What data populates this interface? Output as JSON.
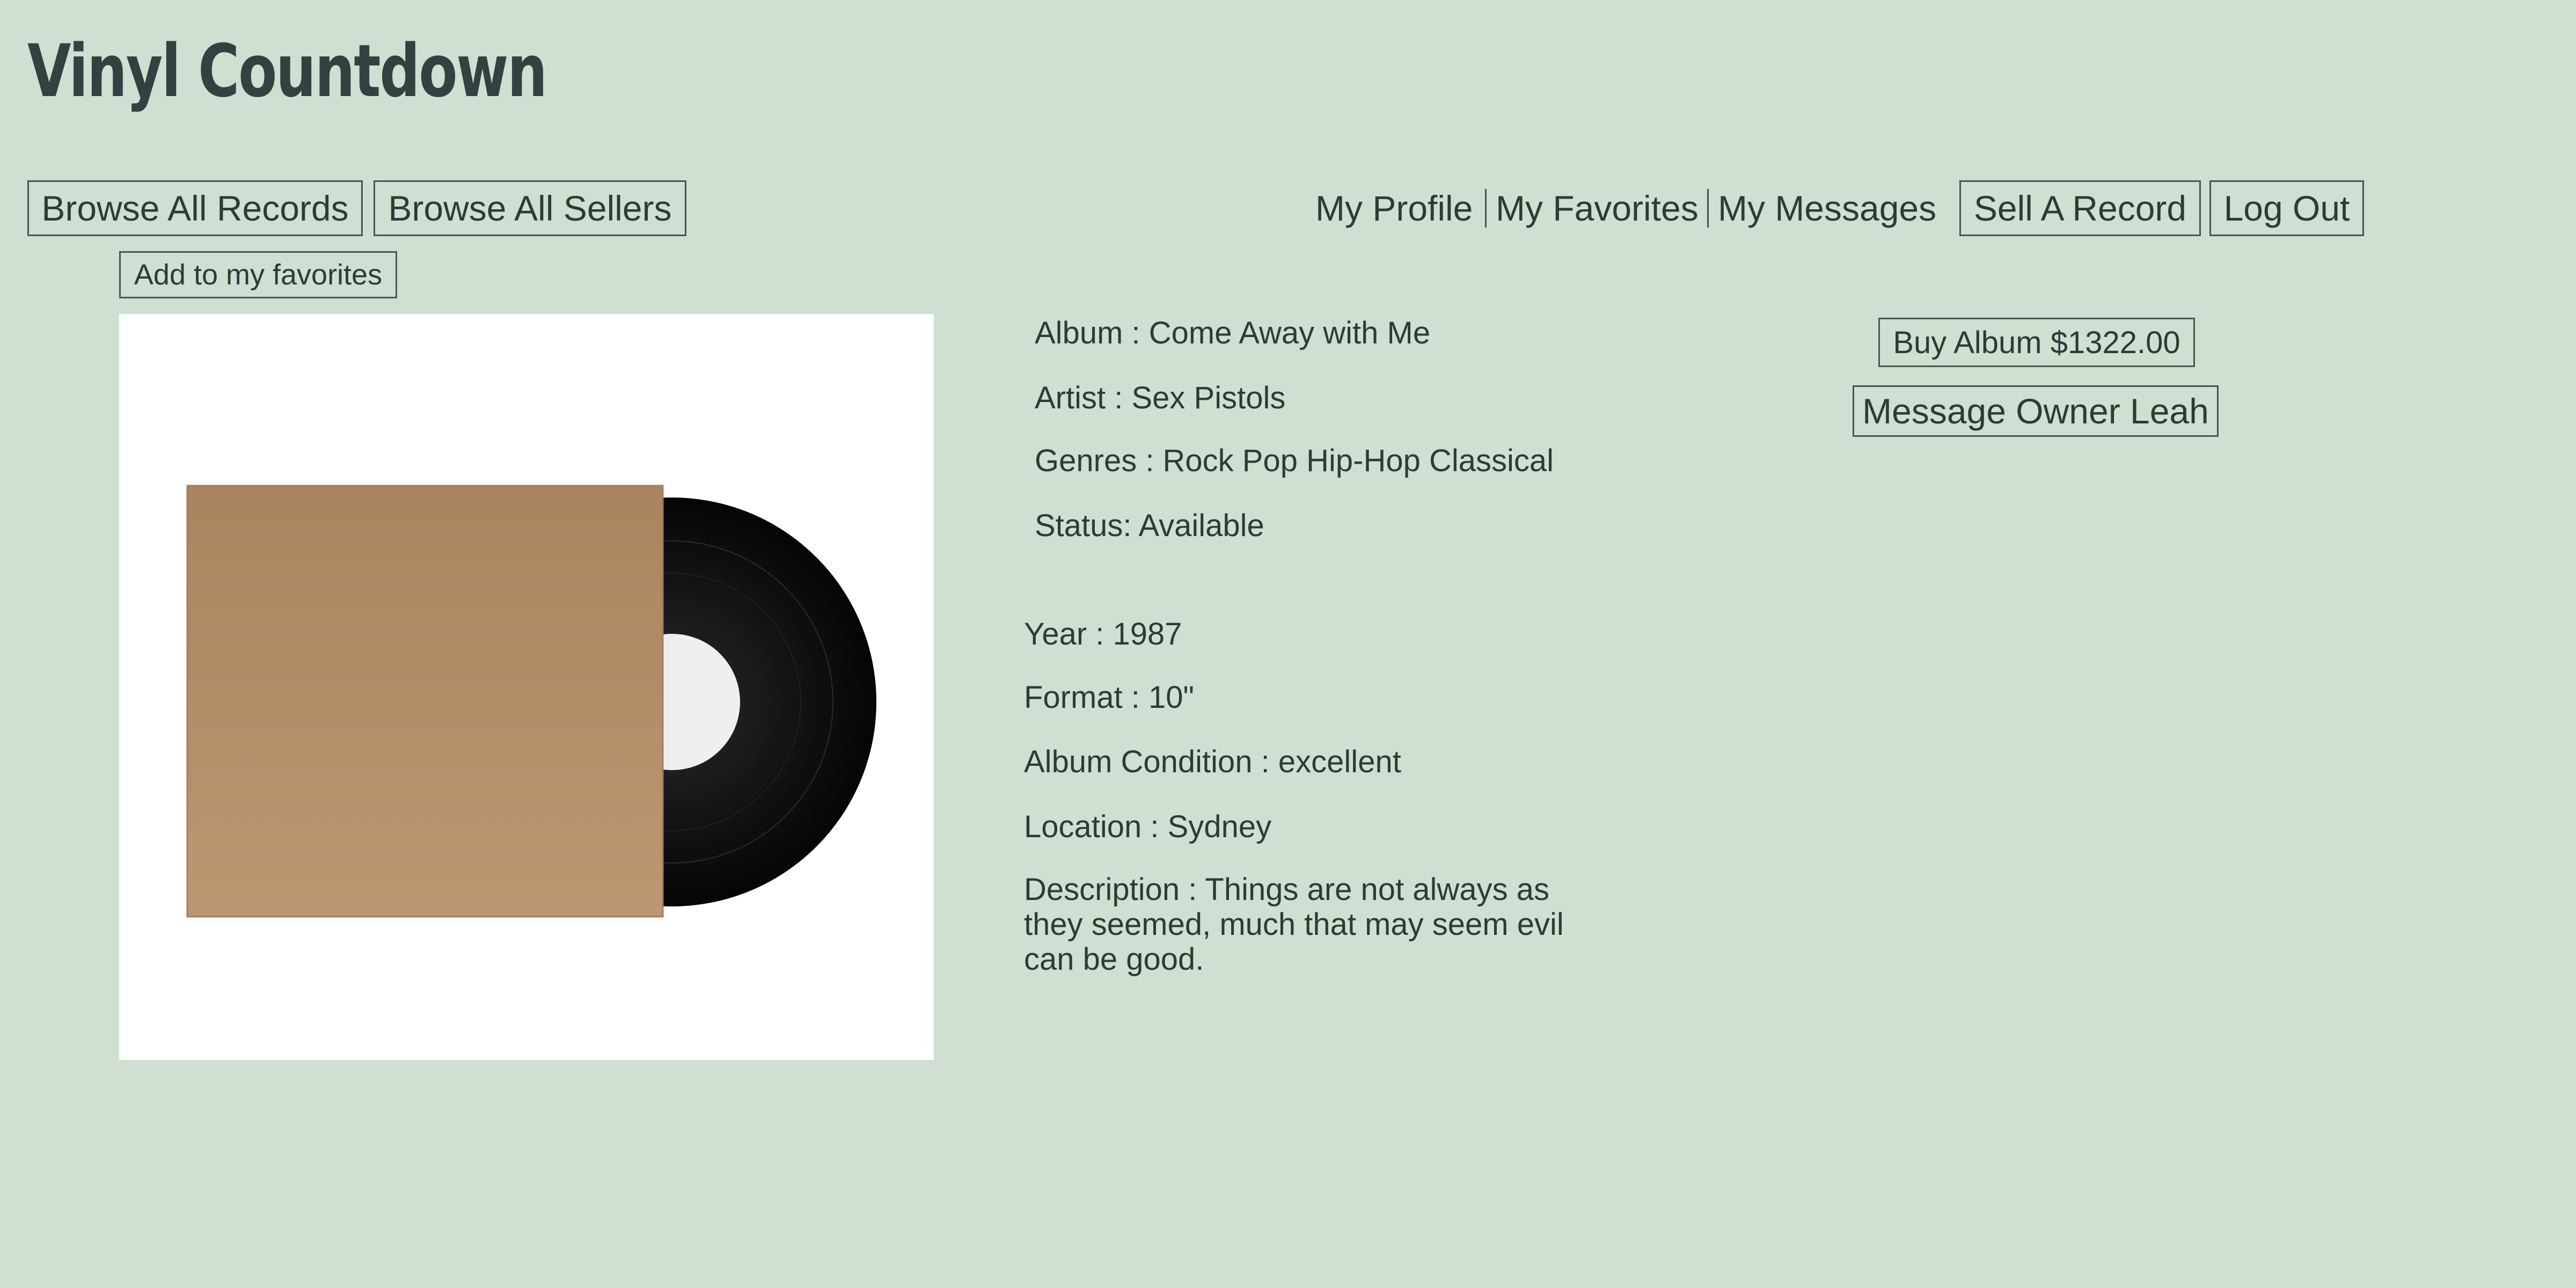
{
  "site": {
    "title": "Vinyl Countdown"
  },
  "nav_left": {
    "browse_records": "Browse All Records",
    "browse_sellers": "Browse All Sellers"
  },
  "nav_right": {
    "profile": "My Profile",
    "favorites": "My Favorites",
    "messages": "My Messages",
    "sell": "Sell A Record",
    "logout": "Log Out"
  },
  "record": {
    "favorite_button": "Add to my favorites",
    "album": "Album : Come Away with Me",
    "artist": "Artist : Sex Pistols",
    "genres": "Genres : Rock Pop Hip-Hop Classical",
    "status": "Status: Available",
    "year": "Year : 1987",
    "format": "Format : 10\"",
    "condition": "Album Condition : excellent",
    "location": "Location : Sydney",
    "description": "Description : Things are not always as they seemed, much that may seem evil can be good."
  },
  "actions": {
    "buy": "Buy Album $1322.00",
    "message_owner": "Message Owner Leah"
  },
  "colors": {
    "background": "#cfdfd1",
    "text": "#2f3a37",
    "title": "#344140",
    "sleeve": "#b8916c",
    "vinyl": "#111214"
  },
  "icons": {
    "record_image": "vinyl-record-with-sleeve"
  }
}
